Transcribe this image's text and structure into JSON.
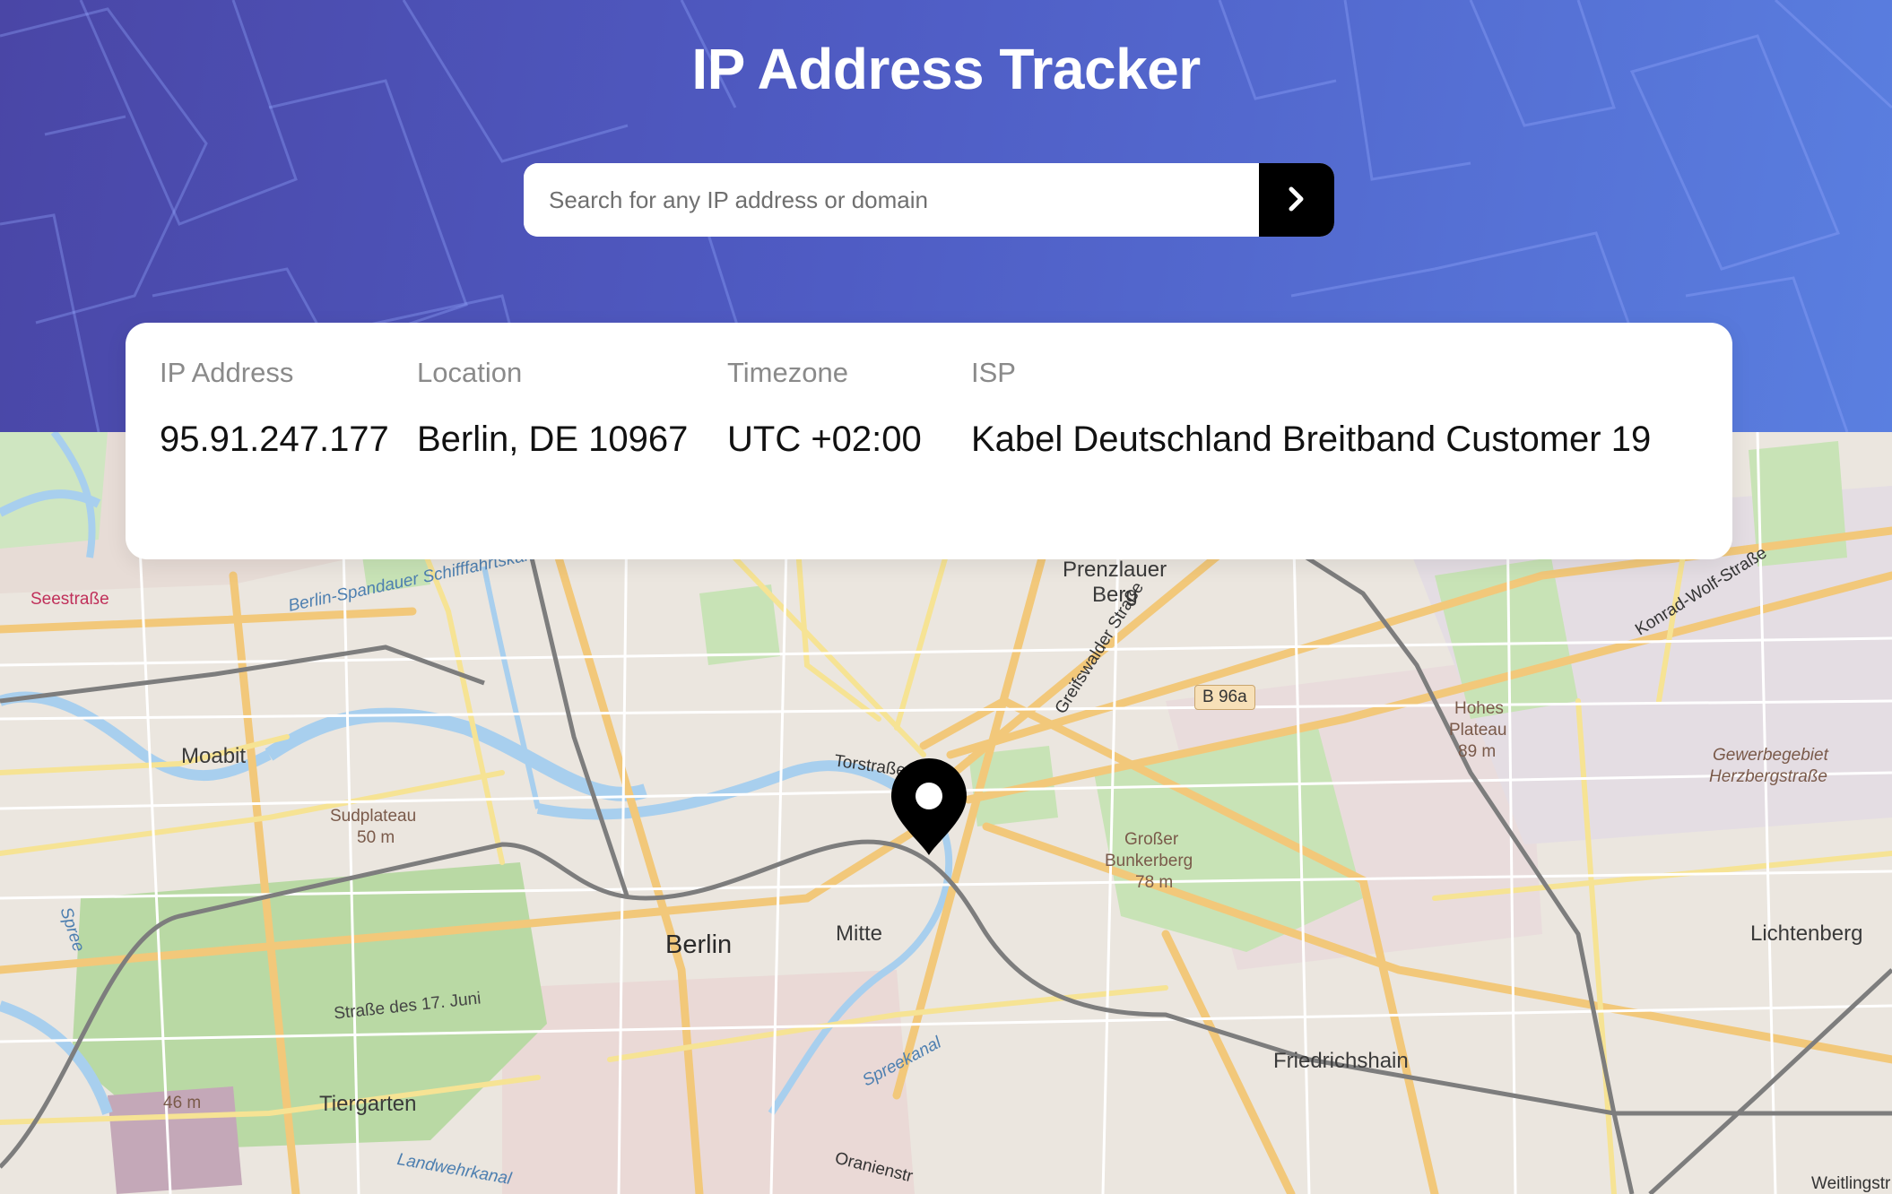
{
  "header": {
    "title": "IP Address Tracker",
    "search_placeholder": "Search for any IP address or domain",
    "search_value": ""
  },
  "info": {
    "ip": {
      "label": "IP Address",
      "value": "95.91.247.177"
    },
    "location": {
      "label": "Location",
      "value": "Berlin, DE 10967"
    },
    "timezone": {
      "label": "Timezone",
      "value": "UTC +02:00"
    },
    "isp": {
      "label": "ISP",
      "value": "Kabel Deutschland Breitband Customer 19"
    }
  },
  "map": {
    "labels": {
      "prenzlauer_berg_1": "Prenzlauer",
      "prenzlauer_berg_2": "Berg",
      "moabit": "Moabit",
      "sudplateau_1": "Sudplateau",
      "sudplateau_2": "50 m",
      "berlin": "Berlin",
      "mitte": "Mitte",
      "tiergarten": "Tiergarten",
      "friedrichshain": "Friedrichshain",
      "lichtenberg": "Lichtenberg",
      "hohes_1": "Hohes",
      "hohes_2": "Plateau",
      "hohes_3": "89 m",
      "grosser_1": "Großer",
      "grosser_2": "Bunkerberg",
      "grosser_3": "78 m",
      "gewerbe_1": "Gewerbegebiet",
      "gewerbe_2": "Herzbergstraße",
      "b96a": "B 96a",
      "seestrasse": "Seestraße",
      "elev46": "46 m",
      "strasse17": "Straße des 17. Juni",
      "spreekanal": "Spreekanal",
      "torstrasse": "Torstraße",
      "greifswalder": "Greifswalder Straße",
      "konrad": "Konrad-Wolf-Straße",
      "landwehr": "Landwehrkanal",
      "schifffahrt": "Berlin-Spandauer Schifffahrtskanal",
      "spree": "Spree",
      "oranien": "Oranienstr",
      "weitling": "Weitlingstr"
    }
  },
  "colors": {
    "hero_start": "#4a46a6",
    "hero_end": "#5a7fe0",
    "button": "#000000",
    "marker": "#000000"
  },
  "icons": {
    "search_button": "chevron-right-icon",
    "map_marker": "location-pin-icon"
  }
}
